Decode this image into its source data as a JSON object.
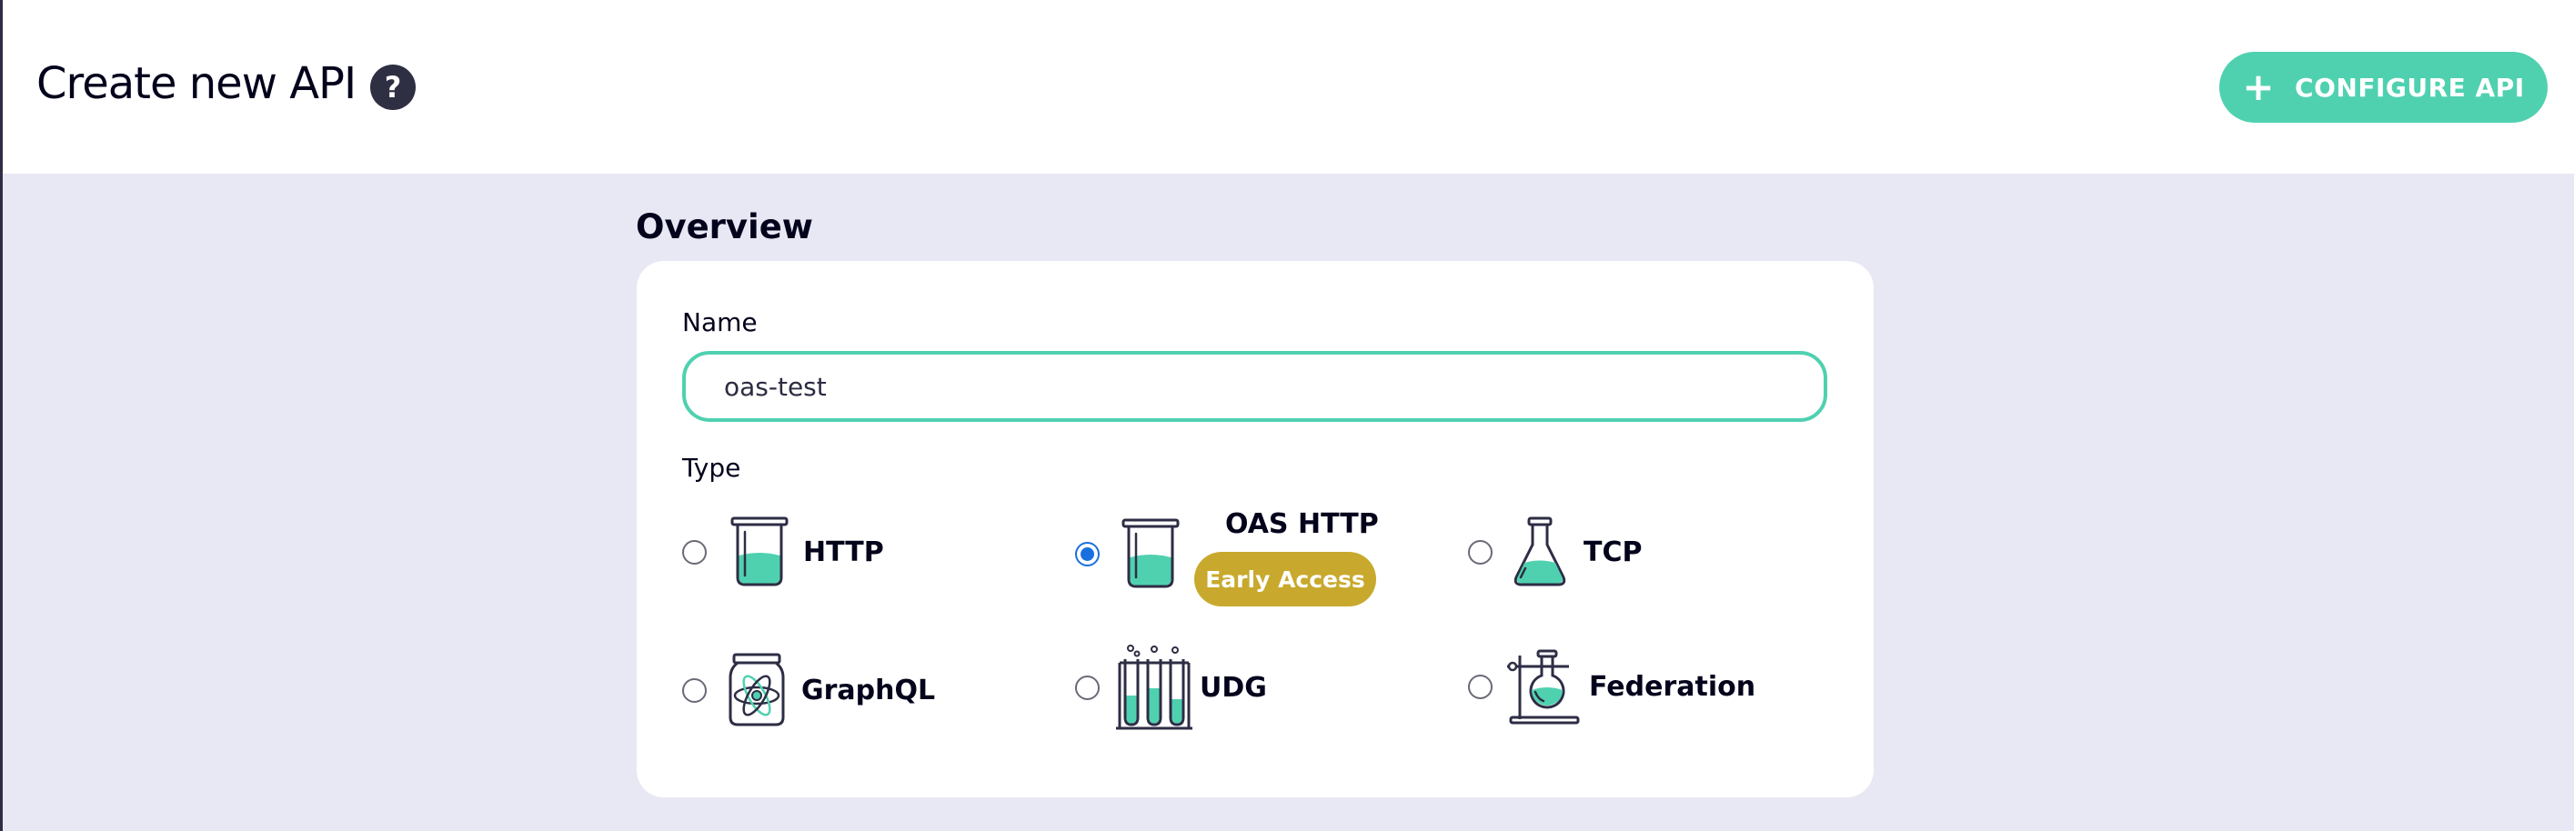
{
  "header": {
    "title": "Create new API",
    "help_icon": "question-mark-icon",
    "configure_button": {
      "label": "CONFIGURE API",
      "icon": "plus-icon"
    }
  },
  "overview": {
    "title": "Overview",
    "name_label": "Name",
    "name_value": "oas-test",
    "type_label": "Type",
    "types": [
      {
        "label": "HTTP",
        "icon": "beaker-icon",
        "selected": false
      },
      {
        "label": "OAS HTTP",
        "icon": "beaker-icon",
        "selected": true,
        "badge": "Early Access"
      },
      {
        "label": "TCP",
        "icon": "flask-icon",
        "selected": false
      },
      {
        "label": "GraphQL",
        "icon": "atom-jar-icon",
        "selected": false
      },
      {
        "label": "UDG",
        "icon": "test-tubes-icon",
        "selected": false
      },
      {
        "label": "Federation",
        "icon": "lab-stand-icon",
        "selected": false
      }
    ]
  },
  "colors": {
    "accent": "#4fd1b0",
    "badge": "#c8a92d",
    "page_background": "#e8e8f4",
    "radio_selected": "#1a6fe0",
    "text": "#03031c"
  }
}
